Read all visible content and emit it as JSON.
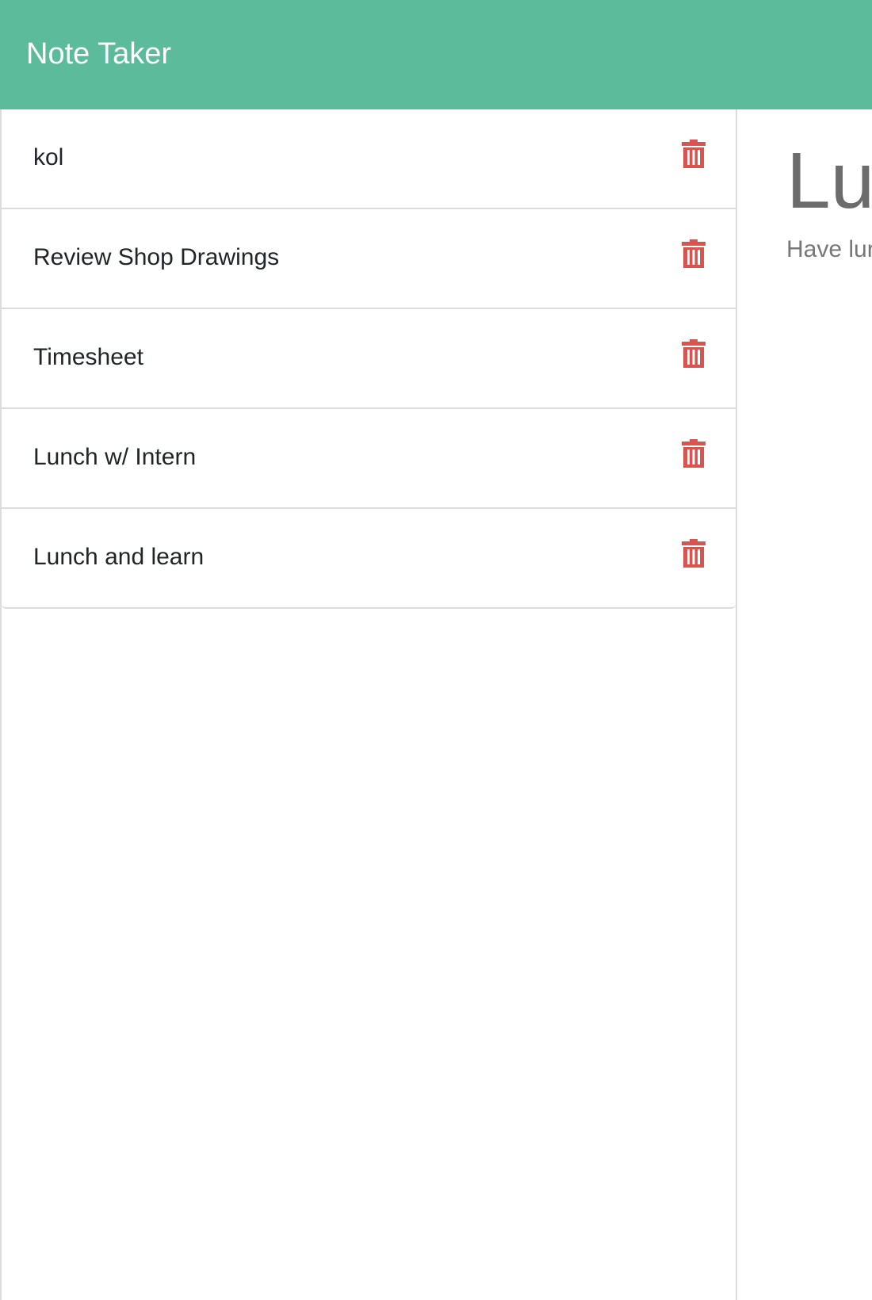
{
  "app": {
    "title": "Note Taker",
    "header_color": "#5cbb9b",
    "delete_color": "#d9534f"
  },
  "notes": [
    {
      "title": "kol",
      "delete_icon": "trash-icon"
    },
    {
      "title": "Review Shop Drawings",
      "delete_icon": "trash-icon"
    },
    {
      "title": "Timesheet",
      "delete_icon": "trash-icon"
    },
    {
      "title": "Lunch w/ Intern",
      "delete_icon": "trash-icon"
    },
    {
      "title": "Lunch and learn",
      "delete_icon": "trash-icon"
    }
  ],
  "active_note": {
    "title": "Lu",
    "text": "Have lur"
  }
}
